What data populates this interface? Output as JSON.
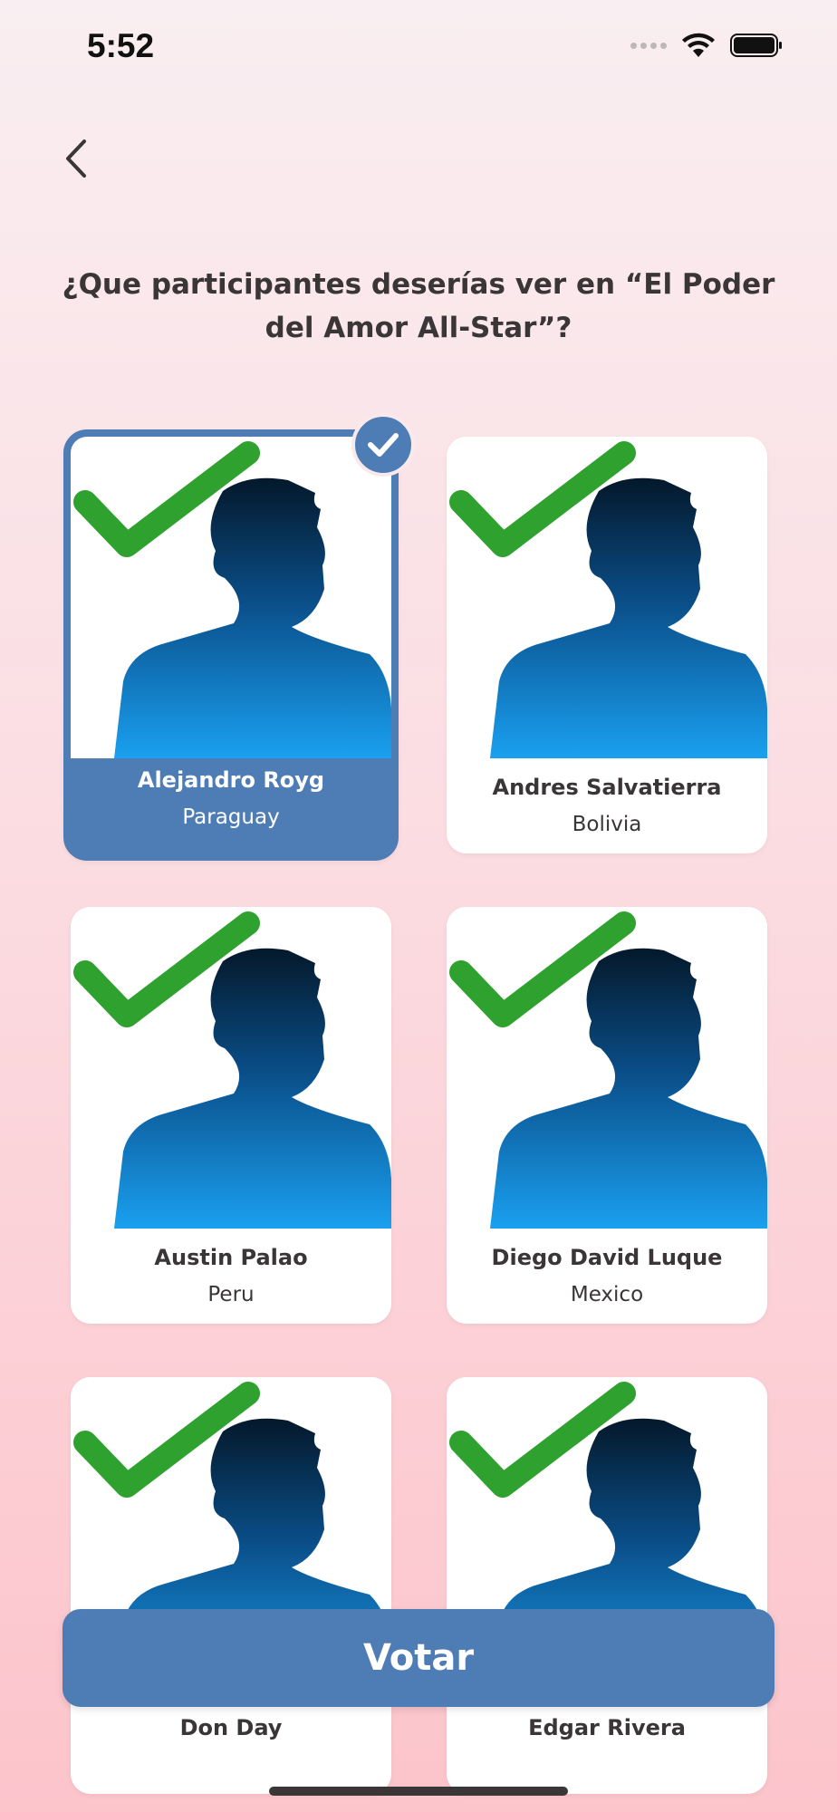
{
  "status": {
    "time": "5:52"
  },
  "question": "¿Que participantes deserías ver en “El Poder del Amor All-Star”?",
  "participants": [
    {
      "name": "Alejandro Royg",
      "country": "Paraguay",
      "selected": true
    },
    {
      "name": "Andres Salvatierra",
      "country": "Bolivia",
      "selected": false
    },
    {
      "name": "Austin Palao",
      "country": "Peru",
      "selected": false
    },
    {
      "name": "Diego David Luque",
      "country": "Mexico",
      "selected": false
    },
    {
      "name": "Don Day",
      "country": "",
      "selected": false
    },
    {
      "name": "Edgar Rivera",
      "country": "",
      "selected": false
    }
  ],
  "vote_button": "Votar",
  "colors": {
    "accent": "#4e7cb5",
    "check_green": "#2ea12e",
    "text": "#3a3537"
  }
}
